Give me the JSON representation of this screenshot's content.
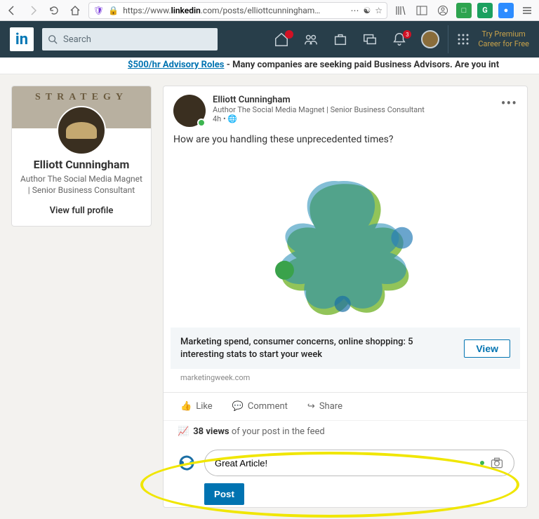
{
  "browser": {
    "url_prefix": "https://www.",
    "url_domain": "linkedin",
    "url_rest": ".com/posts/elliottcunningham",
    "ext1": "□",
    "ext2": "G",
    "ext3": "●"
  },
  "header": {
    "search_placeholder": "Search",
    "badge_notif": "3",
    "premium_l1": "Try Premium",
    "premium_l2": "Career for Free"
  },
  "banner": {
    "link": "$500/hr Advisory Roles",
    "text": " - Many companies are seeking paid Business Advisors. Are you int"
  },
  "sidecard": {
    "bg_text": "STRATEGY",
    "name": "Elliott Cunningham",
    "subtitle": "Author The Social Media Magnet | Senior Business Consultant",
    "view": "View full profile"
  },
  "post": {
    "author": "Elliott Cunningham",
    "meta": "Author The Social Media Magnet | Senior Business Consultant",
    "time": "4h •",
    "text": "How are you handling these unprecedented times?",
    "article_title": "Marketing spend, consumer concerns, online shopping: 5 interesting stats to start your week",
    "view_btn": "View",
    "article_src": "marketingweek.com",
    "like": "Like",
    "comment": "Comment",
    "share": "Share",
    "views_count": "38",
    "views_unit_bold": "views",
    "views_rest": " of your post in the feed"
  },
  "comment": {
    "value": "Great Article!",
    "post_label": "Post"
  }
}
